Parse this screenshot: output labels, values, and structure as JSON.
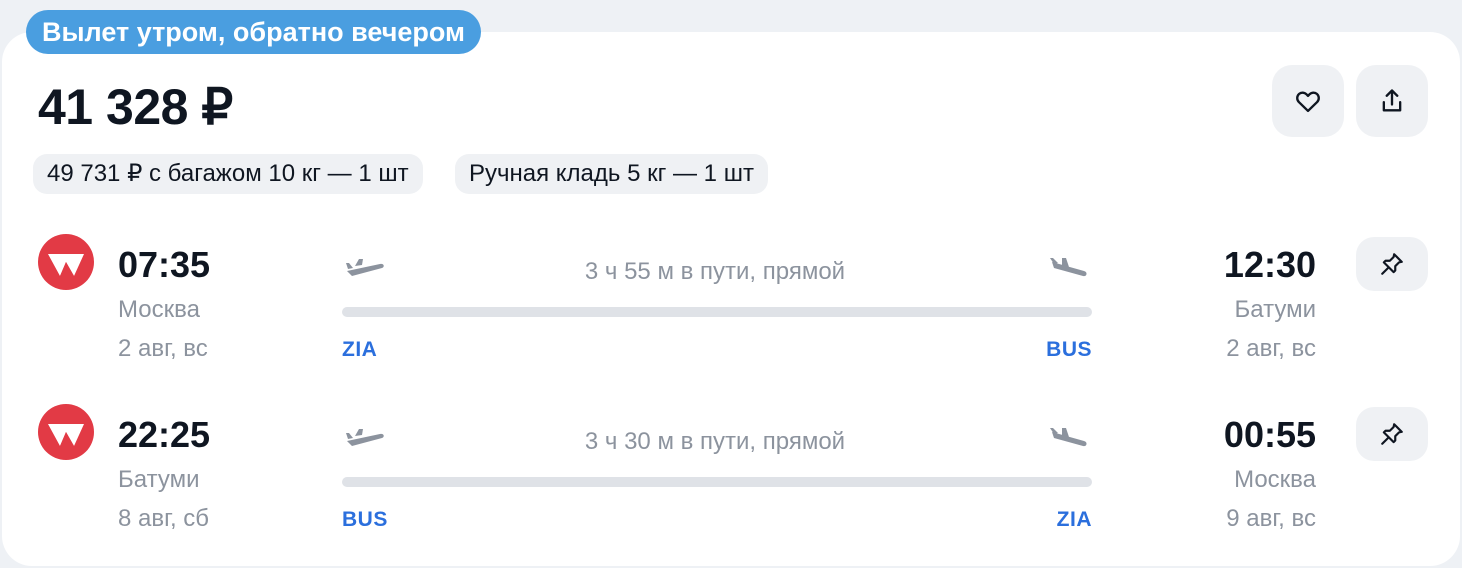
{
  "badge": "Вылет утром, обратно вечером",
  "price": "41 328 ₽",
  "actions": {
    "favorite_icon": "heart-icon",
    "share_icon": "share-icon"
  },
  "chips": {
    "baggage": "49 731 ₽ с багажом 10 кг — 1 шт",
    "hand_luggage": "Ручная кладь 5 кг — 1 шт"
  },
  "segments": [
    {
      "dep_time": "07:35",
      "dep_city": "Москва",
      "dep_date": "2 авг, вс",
      "duration": "3 ч 55 м в пути, прямой",
      "dep_code": "ZIA",
      "arr_code": "BUS",
      "arr_time": "12:30",
      "arr_city": "Батуми",
      "arr_date": "2 авг, вс"
    },
    {
      "dep_time": "22:25",
      "dep_city": "Батуми",
      "dep_date": "8 авг, сб",
      "duration": "3 ч 30 м в пути, прямой",
      "dep_code": "BUS",
      "arr_code": "ZIA",
      "arr_time": "00:55",
      "arr_city": "Москва",
      "arr_date": "9 авг, вс"
    }
  ],
  "colors": {
    "badge": "#4a9ee0",
    "airline_logo": "#e23a45",
    "airport_code": "#2b6fdd"
  }
}
